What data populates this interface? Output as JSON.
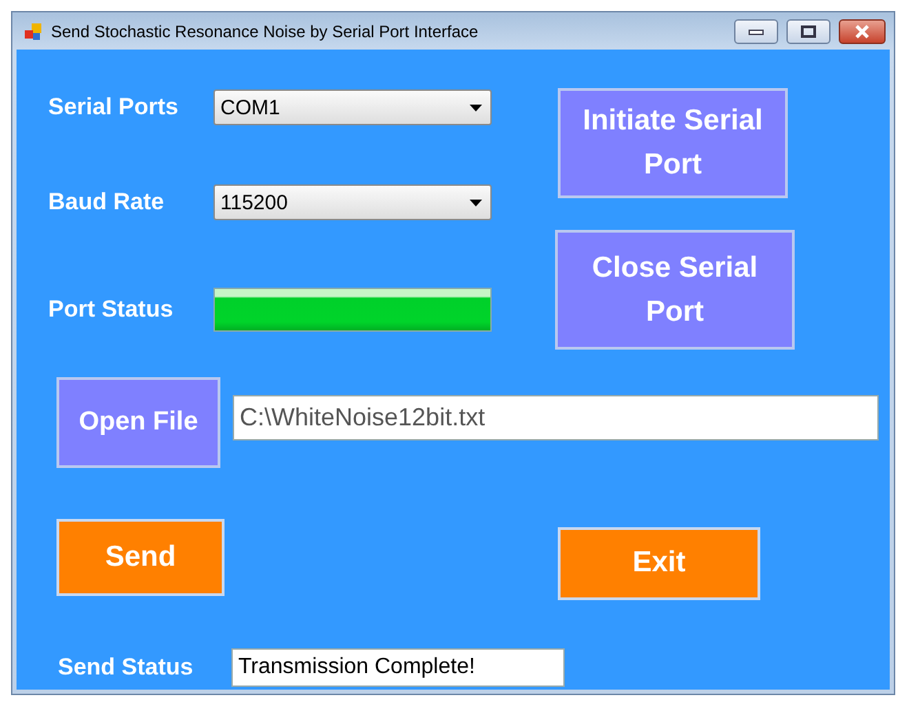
{
  "window": {
    "title": "Send Stochastic Resonance Noise by Serial Port Interface"
  },
  "serial_ports": {
    "label": "Serial Ports",
    "value": "COM1"
  },
  "baud_rate": {
    "label": "Baud Rate",
    "value": "115200"
  },
  "port_status": {
    "label": "Port Status",
    "level": 1
  },
  "initiate_button": "Initiate Serial Port",
  "close_button": "Close Serial Port",
  "open_file_button": "Open File",
  "file_path": {
    "value": "C:\\WhiteNoise12bit.txt"
  },
  "send_button": "Send",
  "exit_button": "Exit",
  "send_status": {
    "label": "Send Status",
    "value": "Transmission Complete!"
  }
}
